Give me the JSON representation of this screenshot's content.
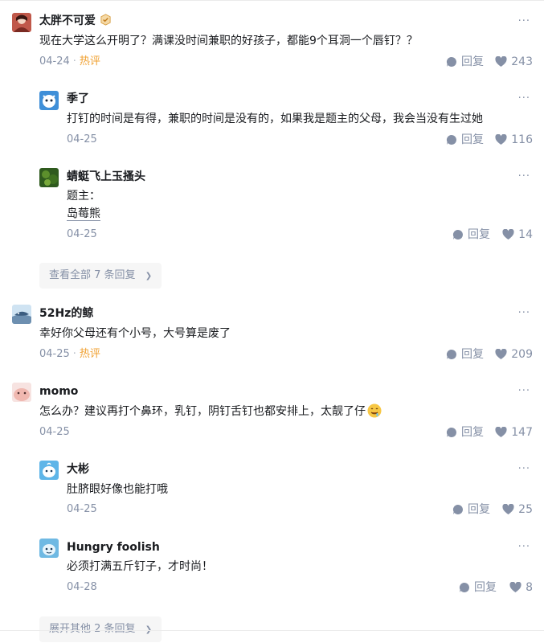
{
  "comments": [
    {
      "author": "太胖不可爱",
      "text": "现在大学这么开明了？满课没时间兼职的好孩子，都能9个耳洞一个唇钉？？",
      "date": "04-24",
      "tag": "热评",
      "reply_label": "回复",
      "likes": "243"
    },
    {
      "author": "季了",
      "text": "打钉的时间是有得，兼职的时间是没有的，如果我是题主的父母，我会当没有生过她",
      "date": "04-25",
      "reply_label": "回复",
      "likes": "116"
    },
    {
      "author": "蜻蜓飞上玉搔头",
      "text_line1": "题主：",
      "text_link": "岛莓熊",
      "date": "04-25",
      "reply_label": "回复",
      "likes": "14"
    },
    {
      "author": "52Hz的鲸",
      "text": "幸好你父母还有个小号，大号算是废了",
      "date": "04-25",
      "tag": "热评",
      "reply_label": "回复",
      "likes": "209"
    },
    {
      "author": "momo",
      "text": "怎么办？建议再打个鼻环，乳钉，阴钉舌钉也都安排上，太靓了仔",
      "date": "04-25",
      "reply_label": "回复",
      "likes": "147"
    },
    {
      "author": "大彬",
      "text": "肚脐眼好像也能打哦",
      "date": "04-25",
      "reply_label": "回复",
      "likes": "25"
    },
    {
      "author": "Hungry foolish",
      "text": "必须打满五斤钉子，才时尚！",
      "date": "04-28",
      "reply_label": "回复",
      "likes": "8"
    }
  ],
  "view_all_replies": "查看全部 7 条回复",
  "expand_more": "展开其他 2 条回复",
  "more_icon": "···",
  "chevron": "❯",
  "dot": "·",
  "colors": {
    "meta": "#8590a6",
    "hot": "#f0a030",
    "text": "#191b1f"
  }
}
